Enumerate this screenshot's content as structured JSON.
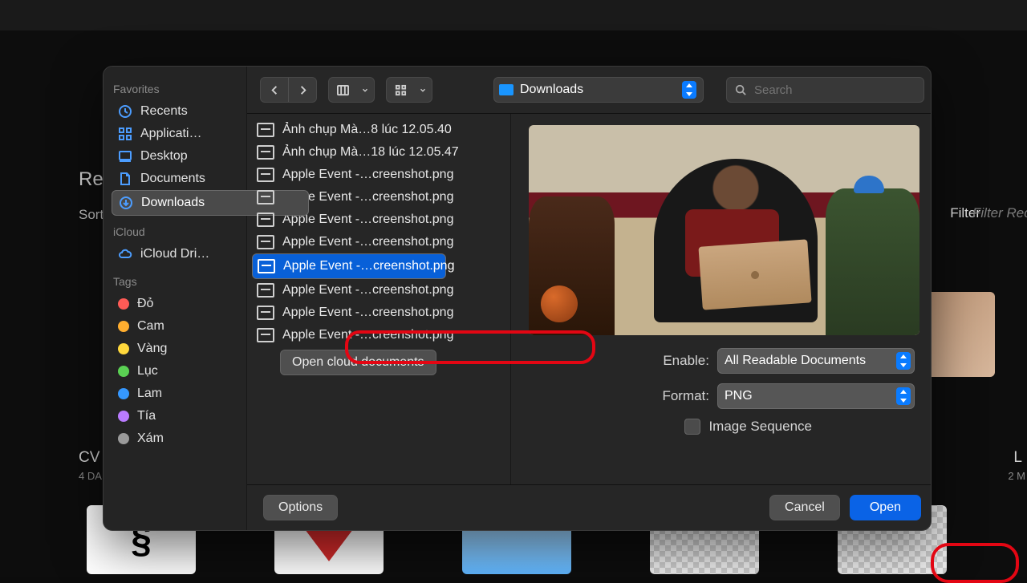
{
  "bg": {
    "left_word": "Re",
    "sort": "Sort",
    "filter": "Filter",
    "filter_hint": "Filter Rece",
    "item1_title": "CV",
    "item1_sub": "4 DA",
    "item2_title": "L",
    "item2_sub": "2 M"
  },
  "sidebar": {
    "heads": {
      "fav": "Favorites",
      "icloud": "iCloud",
      "tags": "Tags"
    },
    "fav": [
      {
        "label": "Recents",
        "icon": "clock"
      },
      {
        "label": "Applicati…",
        "icon": "apps"
      },
      {
        "label": "Desktop",
        "icon": "desktop"
      },
      {
        "label": "Documents",
        "icon": "doc"
      },
      {
        "label": "Downloads",
        "icon": "download",
        "selected": true
      }
    ],
    "icloud": [
      {
        "label": "iCloud Dri…",
        "icon": "cloud"
      }
    ],
    "tags": [
      {
        "label": "Đỏ",
        "color": "#ff5b56"
      },
      {
        "label": "Cam",
        "color": "#ffae2f"
      },
      {
        "label": "Vàng",
        "color": "#ffd83c"
      },
      {
        "label": "Lục",
        "color": "#5ad153"
      },
      {
        "label": "Lam",
        "color": "#3598ff"
      },
      {
        "label": "Tía",
        "color": "#b97bff"
      },
      {
        "label": "Xám",
        "color": "#9a9a9a"
      }
    ]
  },
  "toolbar": {
    "path_label": "Downloads",
    "search_placeholder": "Search"
  },
  "files": [
    {
      "name": "Ảnh chụp Mà…8 lúc 12.05.40"
    },
    {
      "name": "Ảnh chụp Mà…18 lúc 12.05.47"
    },
    {
      "name": "Apple Event -…creenshot.png"
    },
    {
      "name": "Apple Event -…creenshot.png"
    },
    {
      "name": "Apple Event -…creenshot.png"
    },
    {
      "name": "Apple Event -…creenshot.png"
    },
    {
      "name": "Apple Event -…creenshot.png",
      "selected": true
    },
    {
      "name": "Apple Event -…creenshot.png"
    },
    {
      "name": "Apple Event -…creenshot.png"
    },
    {
      "name": "Apple Event -…creenshot.png"
    }
  ],
  "controls": {
    "open_cloud": "Open cloud documents",
    "enable_label": "Enable:",
    "enable_value": "All Readable Documents",
    "format_label": "Format:",
    "format_value": "PNG",
    "image_sequence": "Image Sequence"
  },
  "footer": {
    "options": "Options",
    "cancel": "Cancel",
    "open": "Open"
  }
}
